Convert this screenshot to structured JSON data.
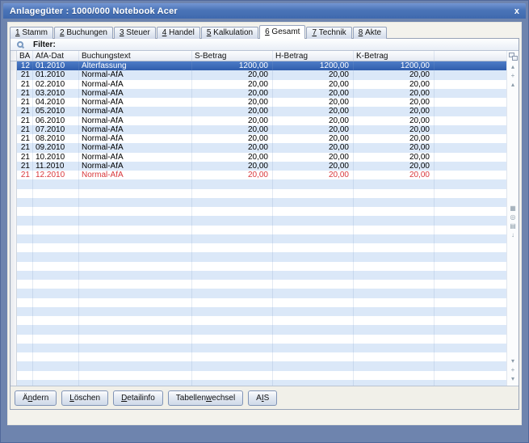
{
  "window": {
    "title": "Anlagegüter : 1000/000 Notebook Acer",
    "close_label": "x"
  },
  "tabs": [
    {
      "num": "1",
      "name": "Stamm",
      "active": false
    },
    {
      "num": "2",
      "name": "Buchungen",
      "active": false
    },
    {
      "num": "3",
      "name": "Steuer",
      "active": false
    },
    {
      "num": "4",
      "name": "Handel",
      "active": false
    },
    {
      "num": "5",
      "name": "Kalkulation",
      "active": false
    },
    {
      "num": "6",
      "name": "Gesamt",
      "active": true
    },
    {
      "num": "7",
      "name": "Technik",
      "active": false
    },
    {
      "num": "8",
      "name": "Akte",
      "active": false
    }
  ],
  "filter": {
    "label": "Filter:"
  },
  "table": {
    "columns": [
      {
        "key": "ba",
        "label": "BA"
      },
      {
        "key": "date",
        "label": "AfA-Dat"
      },
      {
        "key": "text",
        "label": "Buchungstext"
      },
      {
        "key": "s",
        "label": "S-Betrag"
      },
      {
        "key": "h",
        "label": "H-Betrag"
      },
      {
        "key": "k",
        "label": "K-Betrag"
      }
    ],
    "rows": [
      {
        "ba": "12",
        "date": "01.2010",
        "text": "Alterfassung",
        "s": "1200,00",
        "h": "1200,00",
        "k": "1200,00",
        "state": "selected"
      },
      {
        "ba": "21",
        "date": "01.2010",
        "text": "Normal-AfA",
        "s": "20,00",
        "h": "20,00",
        "k": "20,00",
        "state": "normal"
      },
      {
        "ba": "21",
        "date": "02.2010",
        "text": "Normal-AfA",
        "s": "20,00",
        "h": "20,00",
        "k": "20,00",
        "state": "normal"
      },
      {
        "ba": "21",
        "date": "03.2010",
        "text": "Normal-AfA",
        "s": "20,00",
        "h": "20,00",
        "k": "20,00",
        "state": "normal"
      },
      {
        "ba": "21",
        "date": "04.2010",
        "text": "Normal-AfA",
        "s": "20,00",
        "h": "20,00",
        "k": "20,00",
        "state": "normal"
      },
      {
        "ba": "21",
        "date": "05.2010",
        "text": "Normal-AfA",
        "s": "20,00",
        "h": "20,00",
        "k": "20,00",
        "state": "normal"
      },
      {
        "ba": "21",
        "date": "06.2010",
        "text": "Normal-AfA",
        "s": "20,00",
        "h": "20,00",
        "k": "20,00",
        "state": "normal"
      },
      {
        "ba": "21",
        "date": "07.2010",
        "text": "Normal-AfA",
        "s": "20,00",
        "h": "20,00",
        "k": "20,00",
        "state": "normal"
      },
      {
        "ba": "21",
        "date": "08.2010",
        "text": "Normal-AfA",
        "s": "20,00",
        "h": "20,00",
        "k": "20,00",
        "state": "normal"
      },
      {
        "ba": "21",
        "date": "09.2010",
        "text": "Normal-AfA",
        "s": "20,00",
        "h": "20,00",
        "k": "20,00",
        "state": "normal"
      },
      {
        "ba": "21",
        "date": "10.2010",
        "text": "Normal-AfA",
        "s": "20,00",
        "h": "20,00",
        "k": "20,00",
        "state": "normal"
      },
      {
        "ba": "21",
        "date": "11.2010",
        "text": "Normal-AfA",
        "s": "20,00",
        "h": "20,00",
        "k": "20,00",
        "state": "normal"
      },
      {
        "ba": "21",
        "date": "12.2010",
        "text": "Normal-AfA",
        "s": "20,00",
        "h": "20,00",
        "k": "20,00",
        "state": "negative"
      }
    ],
    "empty_row_count": 24
  },
  "gutter": {
    "top_icons": [
      {
        "name": "scroll-to-top-icon",
        "glyph": "▴"
      },
      {
        "name": "locate-record-icon",
        "glyph": "+"
      },
      {
        "name": "scroll-up-icon",
        "glyph": "▴"
      }
    ],
    "mid_icons": [
      {
        "name": "calculator-icon",
        "glyph": "▦"
      },
      {
        "name": "search-icon",
        "glyph": "◎"
      },
      {
        "name": "list-icon",
        "glyph": "▤"
      },
      {
        "name": "scroll-down-icon",
        "glyph": "↓"
      }
    ],
    "bottom_icons": [
      {
        "name": "scroll-down-icon",
        "glyph": "▾"
      },
      {
        "name": "locate-record-icon",
        "glyph": "+"
      },
      {
        "name": "scroll-to-bottom-icon",
        "glyph": "▾"
      }
    ]
  },
  "buttons": [
    {
      "name": "aendern-button",
      "pre": "Ä",
      "u": "n",
      "post": "dern"
    },
    {
      "name": "loeschen-button",
      "pre": "",
      "u": "L",
      "post": "öschen"
    },
    {
      "name": "detailinfo-button",
      "pre": "",
      "u": "D",
      "post": "etailinfo"
    },
    {
      "name": "tabellenwechsel-button",
      "pre": "Tabellen",
      "u": "w",
      "post": "echsel"
    },
    {
      "name": "ais-button",
      "pre": "A",
      "u": "I",
      "post": "S"
    }
  ],
  "colors": {
    "title_bar": "#4a74b8",
    "frame": "#6e84ae",
    "selected_row": "#3567b4",
    "alt_row": "#dbe8f8",
    "negative_text": "#d8383c"
  }
}
